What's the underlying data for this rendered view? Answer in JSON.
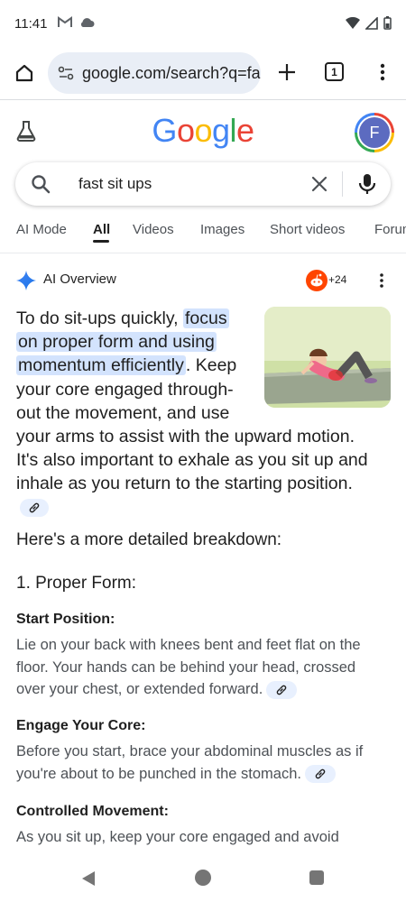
{
  "status_bar": {
    "time": "11:41"
  },
  "browser": {
    "url": "google.com/search?q=fast+sit+ups",
    "tab_count": "1"
  },
  "header": {
    "logo_letters": [
      {
        "ch": "G",
        "color": "#4285f4"
      },
      {
        "ch": "o",
        "color": "#ea4335"
      },
      {
        "ch": "o",
        "color": "#fbbc05"
      },
      {
        "ch": "g",
        "color": "#4285f4"
      },
      {
        "ch": "l",
        "color": "#34a853"
      },
      {
        "ch": "e",
        "color": "#ea4335"
      }
    ],
    "avatar_letter": "F"
  },
  "search": {
    "query": "fast sit ups"
  },
  "tabs": [
    "AI Mode",
    "All",
    "Videos",
    "Images",
    "Short videos",
    "Forums"
  ],
  "active_tab": "All",
  "ai_overview": {
    "label": "AI Overview",
    "source_count": "+24",
    "intro_before": "To do sit-ups quickly, ",
    "intro_highlight_1": "focus",
    "intro_highlight_2": "on proper form and using",
    "intro_highlight_3": "momentum efficiently",
    "intro_line3_after": ". Keep",
    "intro_line4": "your core engaged through-",
    "intro_line5": "out the movement, and use",
    "intro_rest": "your arms to assist with the upward motion. It's also important to exhale as you sit up and inhale as you return to the starting position.",
    "breakdown_intro": "Here's a more detailed breakdown:",
    "section_title": "1. Proper Form:",
    "items": [
      {
        "title": "Start Position:",
        "text": "Lie on your back with knees bent and feet flat on the floor. Your hands can be behind your head, crossed over your chest, or extended forward."
      },
      {
        "title": "Engage Your Core:",
        "text": "Before you start, brace your abdominal muscles as if you're about to be punched in the stomach."
      },
      {
        "title": "Controlled Movement:",
        "text": "As you sit up, keep your core engaged and avoid jerking or swinging. Focus on a smooth, controlled motion."
      }
    ]
  }
}
